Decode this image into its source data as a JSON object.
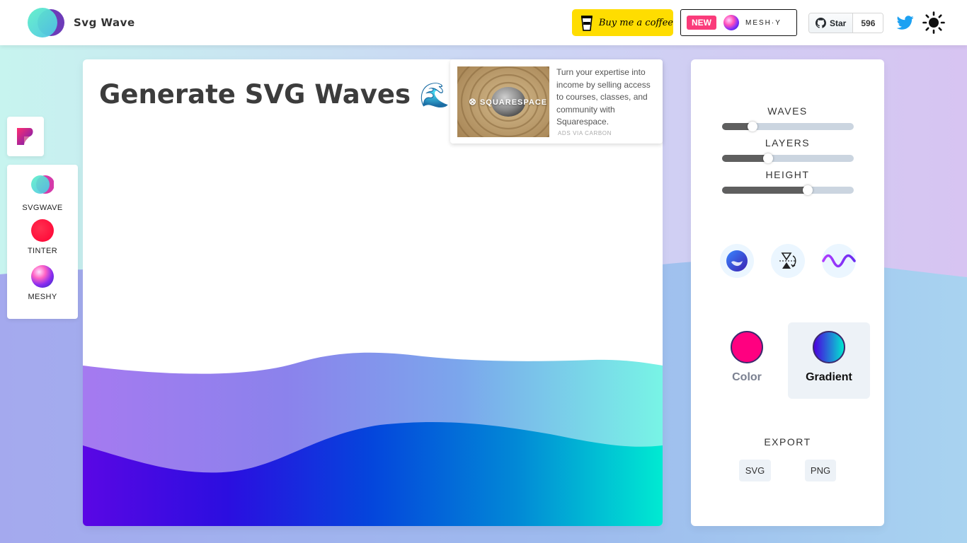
{
  "header": {
    "brand": "Svg Wave",
    "coffee_label": "Buy me a coffee",
    "new_badge": "NEW",
    "meshy_label": "MESH·Y",
    "github": {
      "star_label": "Star",
      "count": "596"
    }
  },
  "dock": {
    "items": [
      {
        "label": "SVGWAVE"
      },
      {
        "label": "TINTER"
      },
      {
        "label": "MESHY"
      }
    ]
  },
  "main": {
    "title": "Generate SVG Waves",
    "title_emoji": "🌊"
  },
  "ad": {
    "brand": "SQUARESPACE",
    "text": "Turn your expertise into income by selling access to courses, classes, and community with Squarespace.",
    "via": "ADS VIA CARBON"
  },
  "panel": {
    "sliders": [
      {
        "label": "WAVES",
        "value": 0.23
      },
      {
        "label": "LAYERS",
        "value": 0.35
      },
      {
        "label": "HEIGHT",
        "value": 0.65
      }
    ],
    "modes": {
      "color_label": "Color",
      "gradient_label": "Gradient",
      "active": "Gradient"
    },
    "export": {
      "label": "EXPORT",
      "svg_label": "SVG",
      "png_label": "PNG"
    }
  },
  "colors": {
    "solid": "#ff0080",
    "gradient_start": "#4b00e0",
    "gradient_end": "#00e8d0",
    "accent_new": "#fa3b7a",
    "coffee_bg": "#ffdd00"
  },
  "icons": [
    "logo-icon",
    "coffee-cup-icon",
    "meshy-orb-icon",
    "github-icon",
    "twitter-icon",
    "sun-icon",
    "tinter-app-icon",
    "svgwave-app-icon",
    "tinter-icon",
    "meshy-icon",
    "randomize-icon",
    "flip-icon",
    "curve-icon"
  ]
}
